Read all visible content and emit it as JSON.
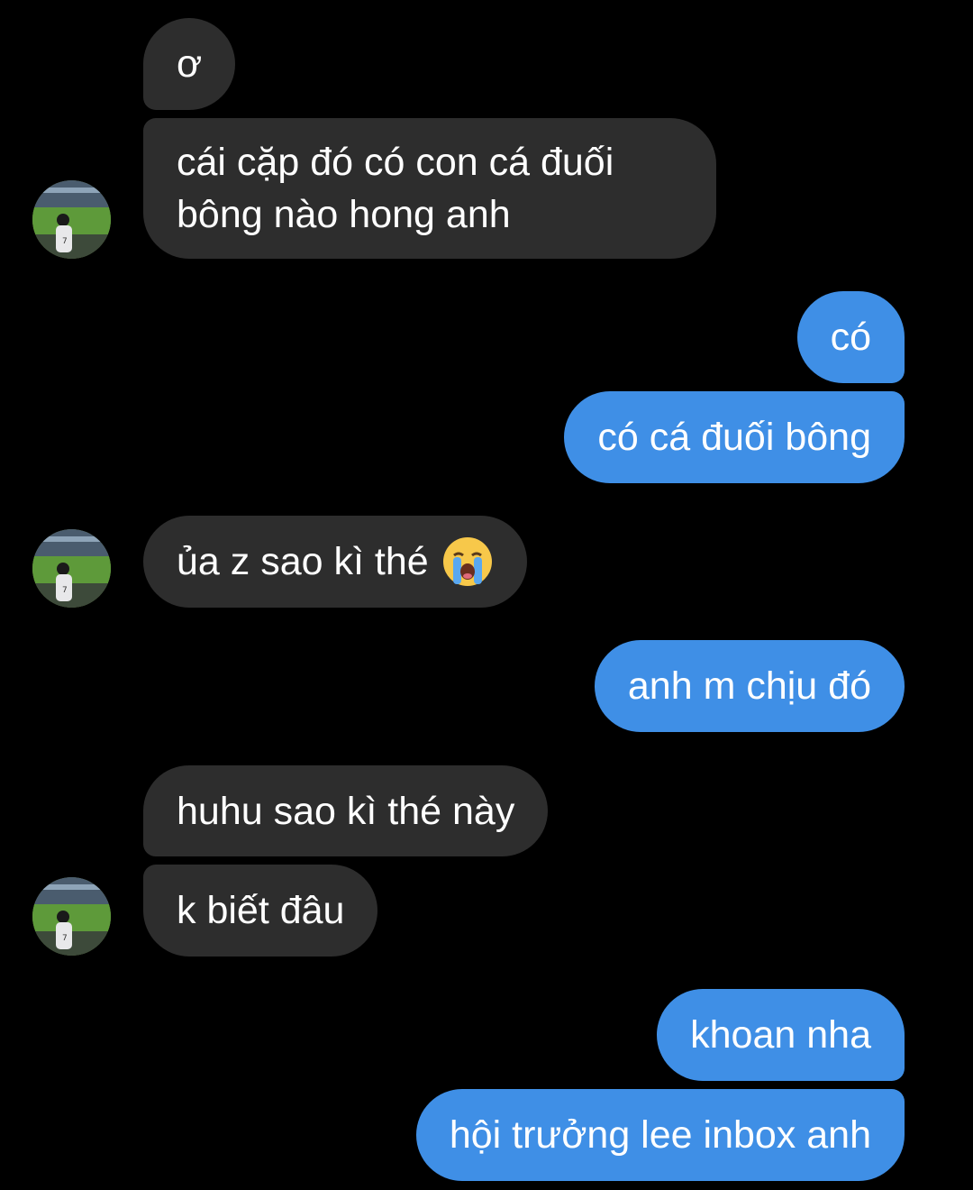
{
  "messages": [
    {
      "side": "received",
      "text": "ơ"
    },
    {
      "side": "received",
      "text": "cái cặp đó có con cá đuối bông nào hong anh"
    },
    {
      "side": "sent",
      "text": "có"
    },
    {
      "side": "sent",
      "text": "có cá đuối bông"
    },
    {
      "side": "received",
      "text": "ủa z sao kì thé",
      "emoji": "loudly-crying-face"
    },
    {
      "side": "sent",
      "text": "anh m chịu đó"
    },
    {
      "side": "received",
      "text": "huhu sao kì thé này"
    },
    {
      "side": "received",
      "text": "k biết đâu"
    },
    {
      "side": "sent",
      "text": "khoan nha"
    },
    {
      "side": "sent",
      "text": "hội trưởng lee inbox anh"
    }
  ],
  "colors": {
    "background": "#000000",
    "received_bubble": "#2d2d2d",
    "sent_bubble": "#3f8fe6",
    "text": "#ffffff"
  }
}
